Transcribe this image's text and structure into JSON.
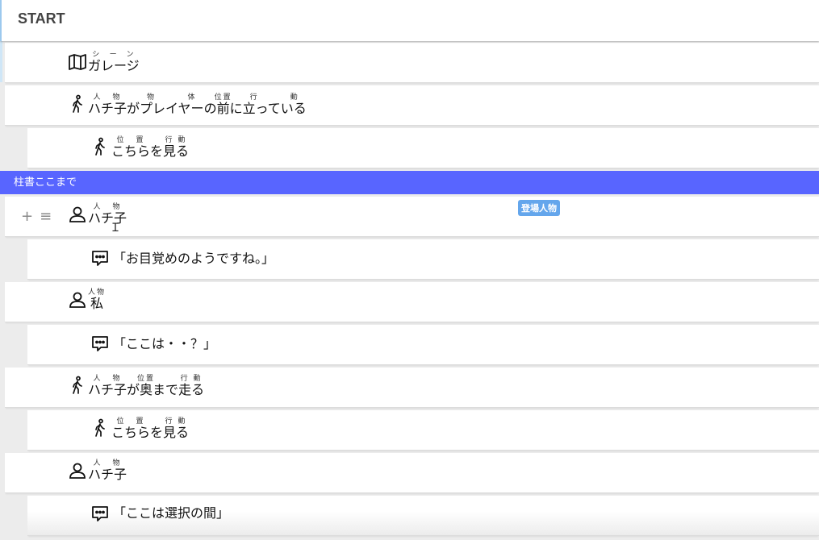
{
  "header": {
    "title": "START"
  },
  "scene_divider": {
    "label": "柱書ここまで"
  },
  "rows": [
    {
      "type": "scene",
      "parts": [
        {
          "base": "ガレージ",
          "ruby": "シーン"
        }
      ]
    },
    {
      "type": "action",
      "parts": [
        {
          "base": "ハチ子",
          "ruby": "人物"
        },
        {
          "base": "が"
        },
        {
          "base": "プレイヤー",
          "ruby": "物体"
        },
        {
          "base": "の"
        },
        {
          "base": "前",
          "ruby": "位置"
        },
        {
          "base": "に"
        },
        {
          "base": "立っている",
          "ruby": "行動"
        }
      ]
    },
    {
      "type": "action-sub",
      "parts": [
        {
          "base": "こちら",
          "ruby": "位置"
        },
        {
          "base": "を"
        },
        {
          "base": "見る",
          "ruby": "行動"
        }
      ]
    },
    {
      "type": "character",
      "parts": [
        {
          "base": "ハチ子",
          "ruby": "人物"
        }
      ],
      "badge": "登場人物"
    },
    {
      "type": "dialogue",
      "text": "「お目覚めのようですね。」"
    },
    {
      "type": "character",
      "parts": [
        {
          "base": "私",
          "ruby": "人物"
        }
      ]
    },
    {
      "type": "dialogue",
      "text": "「ここは・・？」"
    },
    {
      "type": "action",
      "parts": [
        {
          "base": "ハチ子",
          "ruby": "人物"
        },
        {
          "base": "が"
        },
        {
          "base": "奥",
          "ruby": "位置"
        },
        {
          "base": "まで"
        },
        {
          "base": "走る",
          "ruby": "行動"
        }
      ]
    },
    {
      "type": "action-sub",
      "parts": [
        {
          "base": "こちら",
          "ruby": "位置"
        },
        {
          "base": "を"
        },
        {
          "base": "見る",
          "ruby": "行動"
        }
      ]
    },
    {
      "type": "character",
      "parts": [
        {
          "base": "ハチ子",
          "ruby": "人物"
        }
      ]
    },
    {
      "type": "dialogue",
      "text": "「ここは選択の間」"
    }
  ],
  "row_controls": {
    "add": "+",
    "drag": "≡"
  },
  "icons": {
    "scene": "map-icon",
    "action": "walk-icon",
    "character": "person-icon",
    "dialogue": "speech-bubble-icon"
  },
  "colors": {
    "scene_bar": "#5865ff",
    "badge": "#64a6ec"
  }
}
